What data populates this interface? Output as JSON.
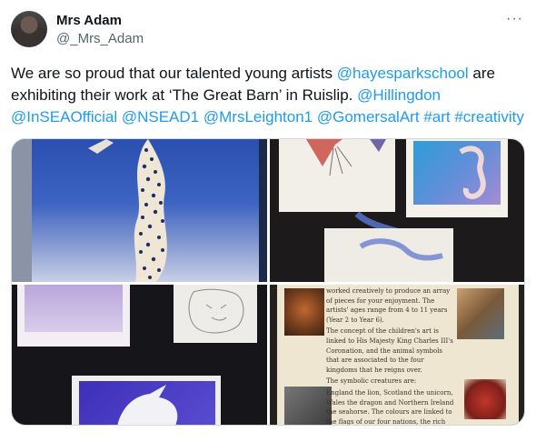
{
  "author": {
    "name": "Mrs Adam",
    "handle": "@_Mrs_Adam"
  },
  "more_label": "···",
  "tweet": {
    "text_1": "We are so proud that our talented young artists ",
    "mention_1": "@hayesparkschool",
    "text_2": " are exhibiting their work at ‘The Great Barn’ in Ruislip. ",
    "mention_2": "@Hillingdon",
    "mention_3": "@InSEAOfficial",
    "mention_4": "@NSEAD1",
    "mention_5": "@MrsLeighton1",
    "mention_6": "@GomersalArt",
    "hashtag_1": "#art",
    "hashtag_2": "#creativity"
  },
  "media": {
    "photo_4_text": [
      "worked creatively to produce an array of pieces for your enjoyment. The artists' ages range from 4 to 11 years (Year 2 to Year 6).",
      "The concept of the children's art is linked to His Majesty King Charles III's Coronation, and the animal symbols that are associated to the four kingdoms that he reigns over.",
      "The symbolic creatures are:",
      "England the lion, Scotland the unicorn, Wales the dragon and Northern Ireland the seahorse. The colours are linked to the flags of our four nations, the rich colours of royalty, purple and gold."
    ]
  },
  "colors": {
    "link": "#1d9bf0",
    "text": "#0f1419",
    "secondary": "#536471"
  }
}
